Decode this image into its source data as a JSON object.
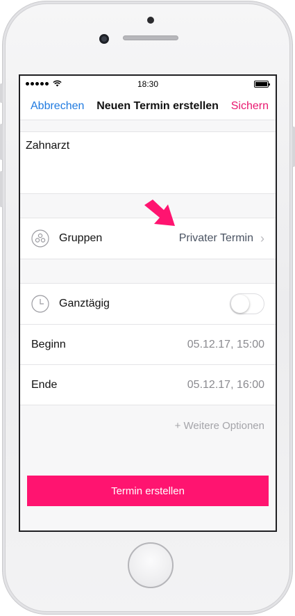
{
  "status_bar": {
    "time": "18:30"
  },
  "nav": {
    "cancel_label": "Abbrechen",
    "title": "Neuen Termin erstellen",
    "save_label": "Sichern"
  },
  "event": {
    "title_value": "Zahnarzt"
  },
  "groups": {
    "label": "Gruppen",
    "value": "Privater Termin"
  },
  "all_day": {
    "label": "Ganztägig",
    "enabled": false
  },
  "start": {
    "label": "Beginn",
    "value": "05.12.17, 15:00"
  },
  "end": {
    "label": "Ende",
    "value": "05.12.17, 16:00"
  },
  "more_options_label": "+ Weitere Optionen",
  "create_button_label": "Termin erstellen",
  "colors": {
    "accent_pink": "#ff1470",
    "link_blue": "#1f7ae0",
    "save_pink": "#e8176f"
  },
  "icons": {
    "groups": "groups-circle-icon",
    "all_day": "clock-icon",
    "chevron": "chevron-right-icon",
    "annotation": "pointer-arrow-icon"
  }
}
